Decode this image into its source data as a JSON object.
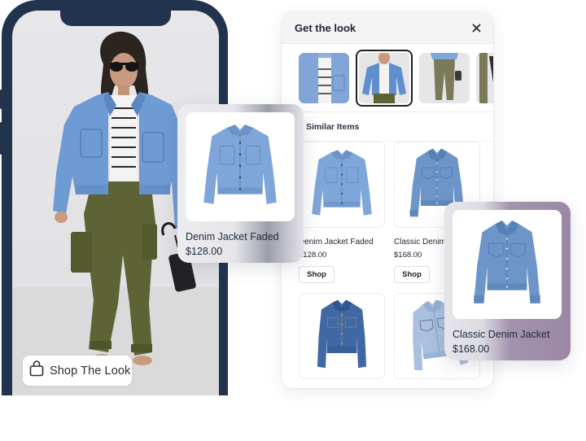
{
  "phone": {
    "shop_the_look_button": "Shop The Look",
    "shop_icon": "shopping-bag-icon"
  },
  "panel": {
    "title": "Get the look",
    "close_icon": "close-icon",
    "thumbnails": [
      {
        "label": "denim-jacket-closeup",
        "selected": false
      },
      {
        "label": "denim-jacket-outfit",
        "selected": true
      },
      {
        "label": "olive-cargo-pants",
        "selected": false
      },
      {
        "label": "black-handbag",
        "selected": false
      }
    ],
    "similar_items_title": "Similar Items",
    "items": [
      {
        "name": "Denim Jacket Faded",
        "price": "$128.00",
        "button": "Shop"
      },
      {
        "name": "Classic Denim Jacket",
        "price": "$168.00",
        "button": "Shop"
      },
      {
        "name": "",
        "price": "",
        "button": ""
      },
      {
        "name": "",
        "price": "",
        "button": ""
      }
    ]
  },
  "floating_cards": [
    {
      "name": "Denim Jacket Faded",
      "price": "$128.00"
    },
    {
      "name": "Classic Denim Jacket",
      "price": "$168.00"
    }
  ],
  "colors": {
    "phone_frame": "#22344d",
    "denim_light": "#7ea6d8",
    "denim_mid": "#5f8fc7",
    "denim_dark": "#3d67a6",
    "olive": "#5d6334",
    "accent_purple": "#9b88a6"
  }
}
